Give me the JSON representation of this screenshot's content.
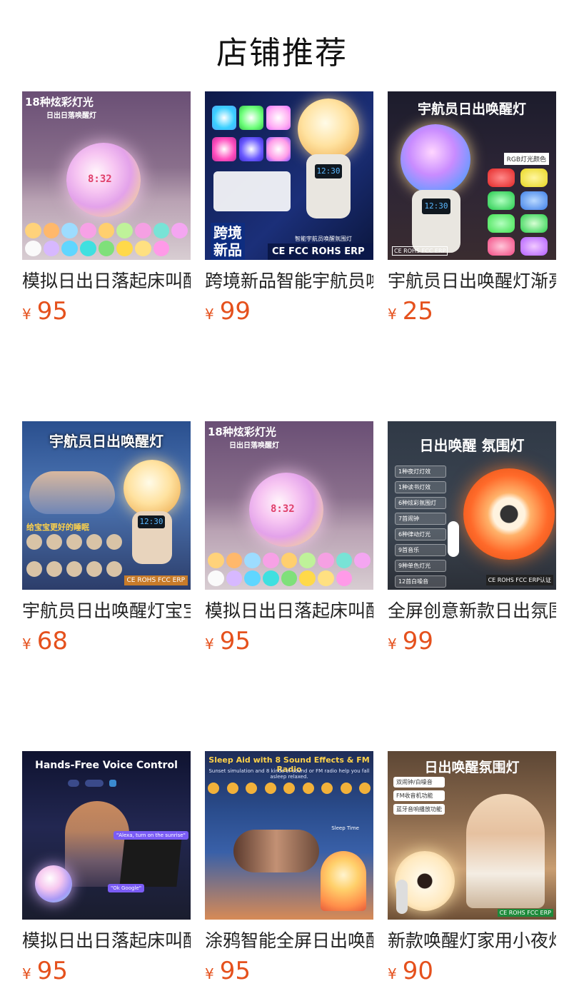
{
  "header": {
    "title": "店铺推荐"
  },
  "currency": "¥",
  "products": [
    {
      "name": "模拟日出日落起床叫醒灯",
      "price": "95",
      "image_text": [
        "18种炫彩灯光",
        "日出日落唤醒灯"
      ],
      "clock": "8:32"
    },
    {
      "name": "跨境新品智能宇航员唤醒灯",
      "price": "99",
      "image_text": [
        "跨境",
        "新品",
        "CE FCC ROHS ERP",
        "智能宇航员唤醒氛围灯"
      ],
      "clock": "12:30"
    },
    {
      "name": "宇航员日出唤醒灯渐亮",
      "price": "25",
      "image_text": [
        "宇航员日出唤醒灯",
        "RGB灯光颜色",
        "CE ROHS FCC ERP"
      ],
      "clock": "12:30"
    },
    {
      "name": "宇航员日出唤醒灯宝宝",
      "price": "68",
      "image_text": [
        "宇航员日出唤醒灯",
        "给宝宝更好的睡眠",
        "CE ROHS FCC ERP"
      ],
      "clock": "12:30"
    },
    {
      "name": "模拟日出日落起床叫醒灯",
      "price": "95",
      "image_text": [
        "18种炫彩灯光",
        "日出日落唤醒灯"
      ],
      "clock": "8:32"
    },
    {
      "name": "全屏创意新款日出氛围灯",
      "price": "99",
      "image_text": [
        "日出唤醒 氛围灯",
        "1种夜灯灯效",
        "1种读书灯效",
        "6种炫彩氛围灯",
        "7首闹钟",
        "6种律动灯光",
        "9首音乐",
        "9种单色灯光",
        "12首白噪音",
        "CE ROHS FCC ERP认证"
      ]
    },
    {
      "name": "模拟日出日落起床叫醒灯",
      "price": "95",
      "image_text": [
        "Hands-Free Voice Control",
        "\"Alexa, turn on the sunrise\"",
        "\"Ok Google\""
      ]
    },
    {
      "name": "涂鸦智能全屏日出唤醒灯",
      "price": "95",
      "image_text": [
        "Sleep Aid with 8 Sound Effects & FM Radio",
        "Sunset simulation and 8 kinds of sound or FM radio help you fall asleep relaxed.",
        "Sleep Time"
      ]
    },
    {
      "name": "新款唤醒灯家用小夜灯",
      "price": "90",
      "image_text": [
        "日出唤醒氛围灯",
        "双闹钟/白噪音",
        "FM收音机功能",
        "蓝牙音响播放功能",
        "CE ROHS FCC ERP"
      ]
    }
  ]
}
